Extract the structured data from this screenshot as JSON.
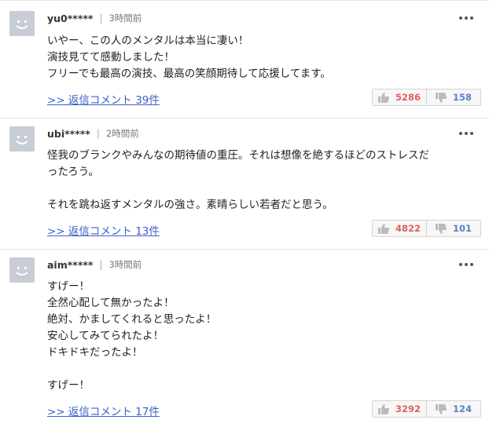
{
  "comments": [
    {
      "user": "yu0*****",
      "separator": "|",
      "time": "3時間前",
      "lines": [
        "いやー、この人のメンタルは本当に凄い！",
        "演技見てて感動しました！",
        "フリーでも最高の演技、最高の笑顔期待して応援してます。"
      ],
      "reply_label": ">> 返信コメント 39件",
      "likes": "5286",
      "dislikes": "158"
    },
    {
      "user": "ubi*****",
      "separator": "|",
      "time": "2時間前",
      "lines": [
        "怪我のブランクやみんなの期待値の重圧。それは想像を絶するほどのストレスだ",
        "ったろう。",
        "",
        "それを跳ね返すメンタルの強さ。素晴らしい若者だと思う。"
      ],
      "reply_label": ">> 返信コメント 13件",
      "likes": "4822",
      "dislikes": "101"
    },
    {
      "user": "aim*****",
      "separator": "|",
      "time": "3時間前",
      "lines": [
        "すげー！",
        "全然心配して無かったよ！",
        "絶対、かましてくれると思ったよ！",
        "安心してみてられたよ！",
        "ドキドキだったよ！",
        "",
        "すげー！"
      ],
      "reply_label": ">> 返信コメント 17件",
      "likes": "3292",
      "dislikes": "124"
    }
  ],
  "icons": {
    "avatar": "smiley-face-icon",
    "more": "more-options-icon",
    "good": "thumbs-up-icon",
    "bad": "thumbs-down-icon"
  },
  "colors": {
    "avatar_bg": "#c7ccd6",
    "link": "#3d5ec9",
    "like_count": "#e06060",
    "dislike_count": "#5a80c8"
  }
}
